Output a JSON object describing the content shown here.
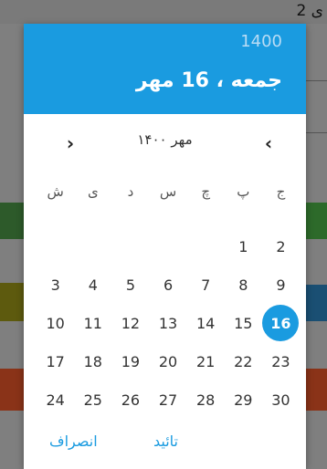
{
  "background": {
    "top_text": "ی 2"
  },
  "dialog": {
    "header": {
      "year": "1400",
      "date_title": "جمعه ، 16 مهر"
    },
    "month_nav": {
      "label": "مهر ۱۴۰۰",
      "prev_icon": "chevron-left-icon",
      "next_icon": "chevron-right-icon"
    },
    "weekdays": [
      "ش",
      "ی",
      "د",
      "س",
      "چ",
      "پ",
      "ج"
    ],
    "weeks": [
      [
        "",
        "",
        "",
        "",
        "",
        "1",
        "2"
      ],
      [
        "3",
        "4",
        "5",
        "6",
        "7",
        "8",
        "9"
      ],
      [
        "10",
        "11",
        "12",
        "13",
        "14",
        "15",
        "16"
      ],
      [
        "17",
        "18",
        "19",
        "20",
        "21",
        "22",
        "23"
      ],
      [
        "24",
        "25",
        "26",
        "27",
        "28",
        "29",
        "30"
      ]
    ],
    "selected_day": "16",
    "actions": {
      "confirm": "تائید",
      "cancel": "انصراف"
    }
  },
  "colors": {
    "accent": "#1a9be0"
  }
}
